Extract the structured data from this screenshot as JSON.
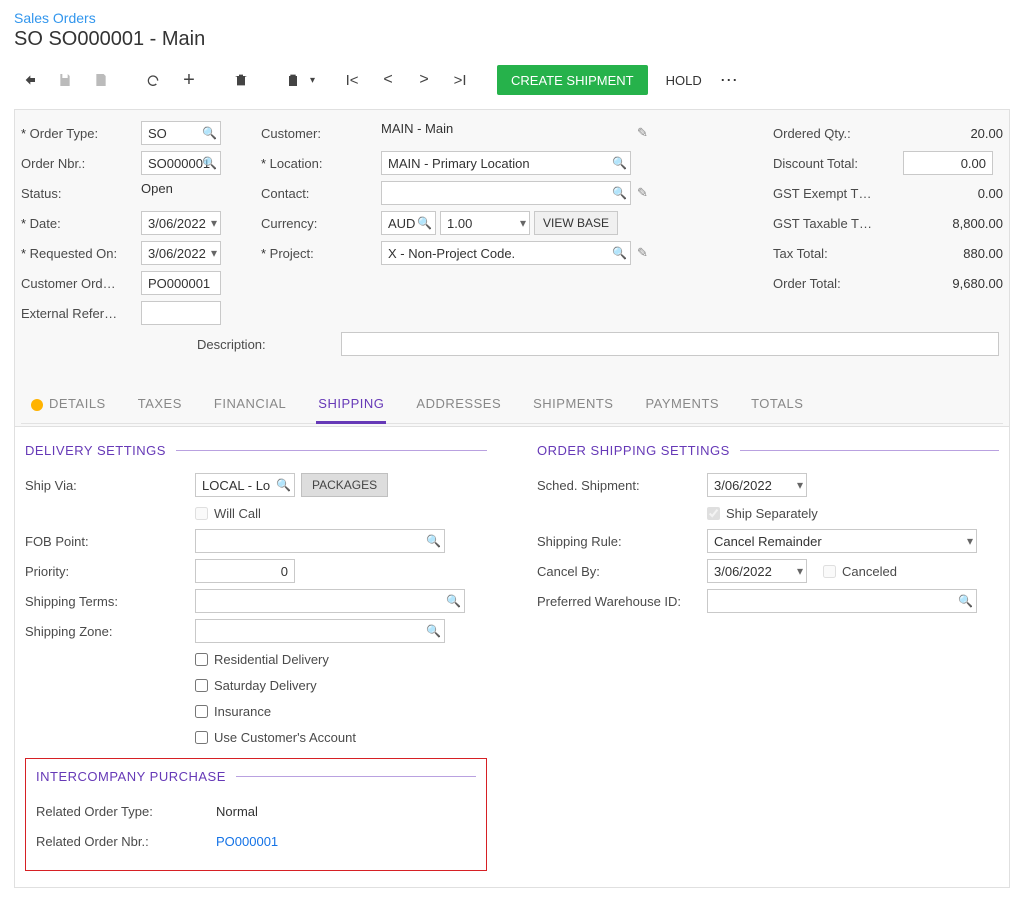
{
  "breadcrumb": "Sales Orders",
  "page_title": "SO SO000001 - Main",
  "toolbar": {
    "create": "CREATE SHIPMENT",
    "hold": "HOLD"
  },
  "header": {
    "order_type_lbl": "Order Type:",
    "order_type": "SO",
    "order_nbr_lbl": "Order Nbr.:",
    "order_nbr": "SO000001",
    "status_lbl": "Status:",
    "status": "Open",
    "date_lbl": "Date:",
    "date": "3/06/2022",
    "requested_lbl": "Requested On:",
    "requested": "3/06/2022",
    "cust_ord_lbl": "Customer Ord…",
    "cust_ord": "PO000001",
    "ext_ref_lbl": "External Refer…",
    "ext_ref": "",
    "customer_lbl": "Customer:",
    "customer": "MAIN - Main",
    "location_lbl": "Location:",
    "location": "MAIN - Primary Location",
    "contact_lbl": "Contact:",
    "contact": "",
    "currency_lbl": "Currency:",
    "currency_code": "AUD",
    "currency_rate": "1.00",
    "view_base": "VIEW BASE",
    "project_lbl": "Project:",
    "project": "X - Non-Project Code.",
    "description_lbl": "Description:",
    "description": ""
  },
  "totals": {
    "ordered_qty_lbl": "Ordered Qty.:",
    "ordered_qty": "20.00",
    "discount_lbl": "Discount Total:",
    "discount": "0.00",
    "gst_exempt_lbl": "GST Exempt T…",
    "gst_exempt": "0.00",
    "gst_tax_lbl": "GST Taxable T…",
    "gst_tax": "8,800.00",
    "tax_total_lbl": "Tax Total:",
    "tax_total": "880.00",
    "order_total_lbl": "Order Total:",
    "order_total": "9,680.00"
  },
  "tabs": {
    "details": "DETAILS",
    "taxes": "TAXES",
    "financial": "FINANCIAL",
    "shipping": "SHIPPING",
    "addresses": "ADDRESSES",
    "shipments": "SHIPMENTS",
    "payments": "PAYMENTS",
    "totals": "TOTALS"
  },
  "delivery": {
    "title": "DELIVERY SETTINGS",
    "ship_via_lbl": "Ship Via:",
    "ship_via": "LOCAL - Lo",
    "packages": "PACKAGES",
    "will_call": "Will Call",
    "fob_lbl": "FOB Point:",
    "fob": "",
    "priority_lbl": "Priority:",
    "priority": "0",
    "terms_lbl": "Shipping Terms:",
    "terms": "",
    "zone_lbl": "Shipping Zone:",
    "zone": "",
    "residential": "Residential Delivery",
    "saturday": "Saturday Delivery",
    "insurance": "Insurance",
    "use_acct": "Use Customer's Account"
  },
  "order_ship": {
    "title": "ORDER SHIPPING SETTINGS",
    "sched_lbl": "Sched. Shipment:",
    "sched": "3/06/2022",
    "ship_sep": "Ship Separately",
    "rule_lbl": "Shipping Rule:",
    "rule": "Cancel Remainder",
    "cancel_by_lbl": "Cancel By:",
    "cancel_by": "3/06/2022",
    "canceled": "Canceled",
    "pref_wh_lbl": "Preferred Warehouse ID:",
    "pref_wh": ""
  },
  "interco": {
    "title": "INTERCOMPANY PURCHASE",
    "type_lbl": "Related Order Type:",
    "type": "Normal",
    "nbr_lbl": "Related Order Nbr.:",
    "nbr": "PO000001"
  }
}
